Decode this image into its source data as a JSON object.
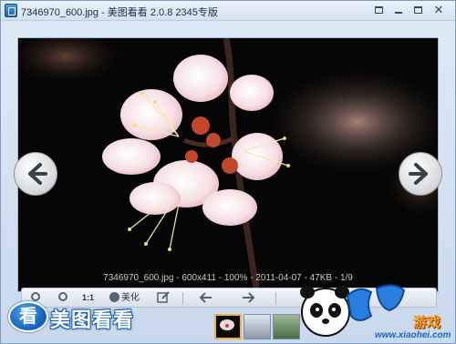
{
  "window": {
    "title": "7346970_600.jpg - 美图看看 2.0.8 2345专版"
  },
  "viewer": {
    "info": "7346970_600.jpg - 600x411 - 100% - 2011-04-07 - 47KB - 1/9"
  },
  "toolbar": {
    "actual_size_label": "1:1",
    "beautify_label": "美化"
  },
  "brand": {
    "badge": "看",
    "name": "美图看看"
  },
  "watermark": {
    "game_text": "游戏",
    "site": "www.xiaohei.com"
  },
  "icons": {
    "nav_prev": "arrow-left-icon",
    "nav_next": "arrow-right-icon"
  },
  "colors": {
    "accent": "#1a61b3",
    "thumbnail_active": "#f2b233"
  }
}
